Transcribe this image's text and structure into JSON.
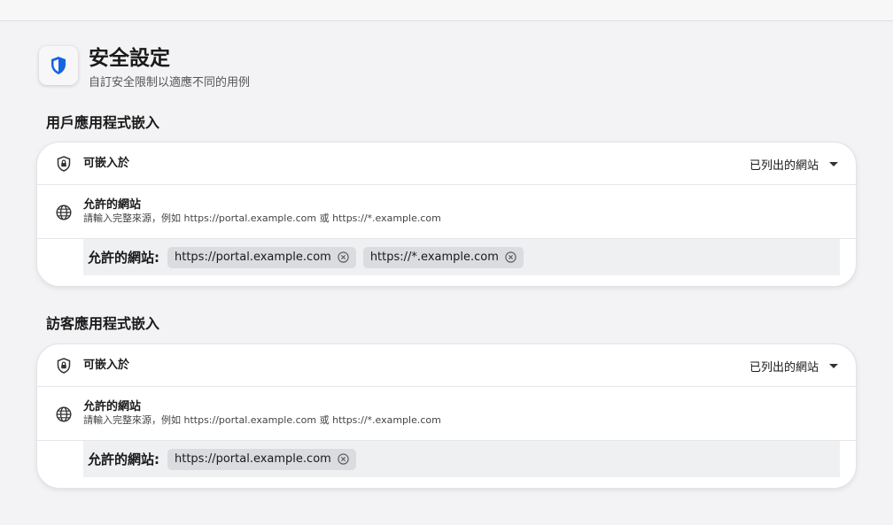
{
  "header": {
    "title": "安全設定",
    "subtitle": "自訂安全限制以適應不同的用例"
  },
  "sections": [
    {
      "title": "用戶應用程式嵌入",
      "embed_label": "可嵌入於",
      "embed_value": "已列出的網站",
      "allowed_title": "允許的網站",
      "allowed_hint": "請輸入完整來源，例如 https://portal.example.com 或 https://*.example.com",
      "sites_label": "允許的網站:",
      "sites": [
        "https://portal.example.com",
        "https://*.example.com"
      ]
    },
    {
      "title": "訪客應用程式嵌入",
      "embed_label": "可嵌入於",
      "embed_value": "已列出的網站",
      "allowed_title": "允許的網站",
      "allowed_hint": "請輸入完整來源，例如 https://portal.example.com 或 https://*.example.com",
      "sites_label": "允許的網站:",
      "sites": [
        "https://portal.example.com"
      ]
    }
  ],
  "icons": {
    "header": "shield-check-icon",
    "embed": "shield-lock-icon",
    "allowed": "globe-icon",
    "chip_remove": "close-circle-icon",
    "dropdown": "caret-down-icon"
  },
  "colors": {
    "accent": "#1565e0",
    "background": "#f3f3f5",
    "chip": "#dadcdf",
    "sites_bar": "#eef0f2"
  }
}
